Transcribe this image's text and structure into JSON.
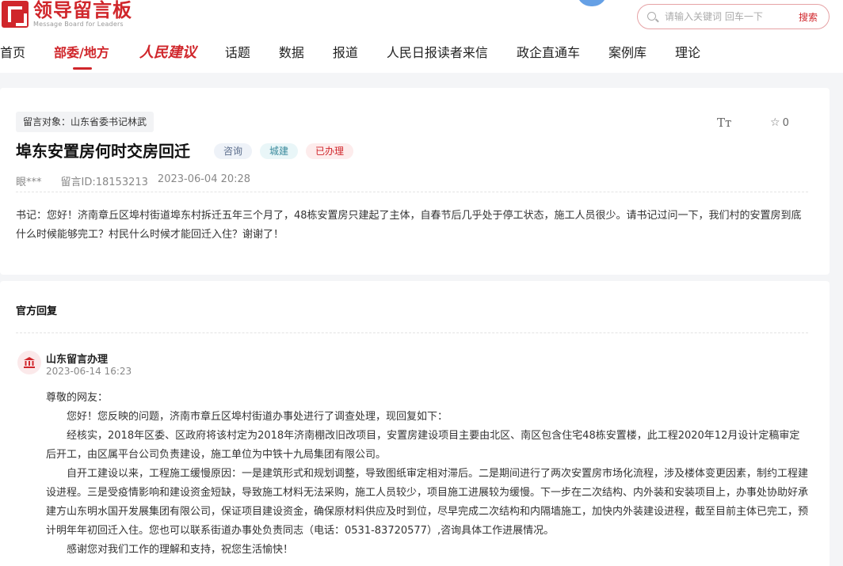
{
  "brand": {
    "name_cn": "领导留言板",
    "name_en": "Message Board for Leaders",
    "color": "#d0262b"
  },
  "search": {
    "placeholder": "请输入关键词 回车一下",
    "button": "搜索"
  },
  "nav": [
    "首页",
    "部委/地方",
    "人民建议",
    "话题",
    "数据",
    "报道",
    "人民日报读者来信",
    "政企直通车",
    "案例库",
    "理论"
  ],
  "question": {
    "target": "留言对象：山东省委书记林武",
    "title": "埠东安置房何时交房回迁",
    "tags": [
      "咨询",
      "城建",
      "已办理"
    ],
    "author": "眼***",
    "id": "留言ID:18153213",
    "time": "2023-06-04 20:28",
    "font_icon": "Tт",
    "star_count": "0",
    "body": "书记：您好！济南章丘区埠村街道埠东村拆迁五年三个月了，48栋安置房只建起了主体，自春节后几乎处于停工状态，施工人员很少。请书记过问一下，我们村的安置房到底什么时候能够完工？村民什么时候才能回迁入住？谢谢了！"
  },
  "reply": {
    "section_title": "官方回复",
    "org": "山东留言办理",
    "time": "2023-06-14 16:23",
    "paragraphs": [
      "尊敬的网友：",
      "您好！您反映的问题，济南市章丘区埠村街道办事处进行了调查处理，现回复如下：",
      "经核实，2018年区委、区政府将该村定为2018年济南棚改旧改项目，安置房建设项目主要由北区、南区包含住宅48栋安置楼，此工程2020年12月设计定稿审定后开工，由区属平台公司负责建设，施工单位为中铁十九局集团有限公司。",
      "自开工建设以来，工程施工缓慢原因：一是建筑形式和规划调整，导致图纸审定相对滞后。二是期间进行了两次安置房市场化流程，涉及楼体变更因素，制约工程建设进程。三是受疫情影响和建设资金短缺，导致施工材料无法采购，施工人员较少，项目施工进展较为缓慢。下一步在二次结构、内外装和安装项目上，办事处协助好承建方山东明水国开发展集团有限公司，保证项目建设资金，确保原材料供应及时到位，尽早完成二次结构和内隔墙施工，加快内外装建设进程，截至目前主体已完工，预计明年年初回迁入住。您也可以联系街道办事处负责同志（电话：0531-83720577）,咨询具体工作进展情况。",
      "感谢您对我们工作的理解和支持，祝您生活愉快！"
    ]
  }
}
